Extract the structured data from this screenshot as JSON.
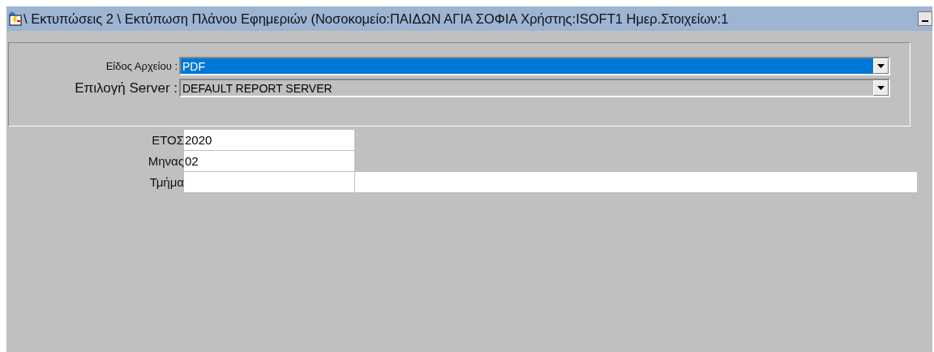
{
  "window": {
    "title": "\\ Εκτυπώσεις 2 \\ Εκτύπωση Πλάνου Εφημεριών (Νοσοκομείο:ΠΑΙΔΩΝ ΑΓΙΑ ΣΟΦΙΑ Χρήστης:ISOFT1 Ημερ.Στοιχείων:1"
  },
  "options": [
    {
      "label": "Είδος Αρχείου :",
      "value": "PDF",
      "focused": true
    },
    {
      "label": "Επιλογή Server :",
      "value": "DEFAULT REPORT SERVER",
      "focused": false
    }
  ],
  "fields": [
    {
      "label": "ΕΤΟΣ",
      "value": "2020",
      "extra_field": false
    },
    {
      "label": "Μηνας",
      "value": "02",
      "extra_field": false
    },
    {
      "label": "Τμήμα",
      "extra_field": true
    }
  ]
}
